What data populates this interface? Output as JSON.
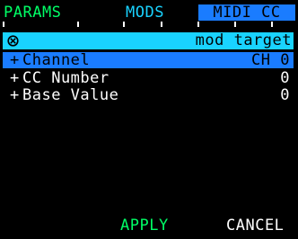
{
  "tabs": {
    "params": "PARAMS",
    "mods": "MODS",
    "midi_cc": "MIDI CC",
    "active": "midi_cc"
  },
  "header": {
    "icon": "target-icon",
    "label": "mod target"
  },
  "rows": [
    {
      "bullet": "+",
      "name": "Channel",
      "value": "CH 0",
      "selected": true
    },
    {
      "bullet": "+",
      "name": "CC Number",
      "value": "0",
      "selected": false
    },
    {
      "bullet": "+",
      "name": "Base Value",
      "value": "0",
      "selected": false
    }
  ],
  "buttons": {
    "apply": "APPLY",
    "cancel": "CANCEL"
  },
  "colors": {
    "background": "#000000",
    "params_tab": "#00ff66",
    "mods_tab": "#19d3ff",
    "selection": "#1a7cff",
    "header_bar": "#19d3ff",
    "apply": "#00ff66",
    "text": "#ffffff"
  }
}
